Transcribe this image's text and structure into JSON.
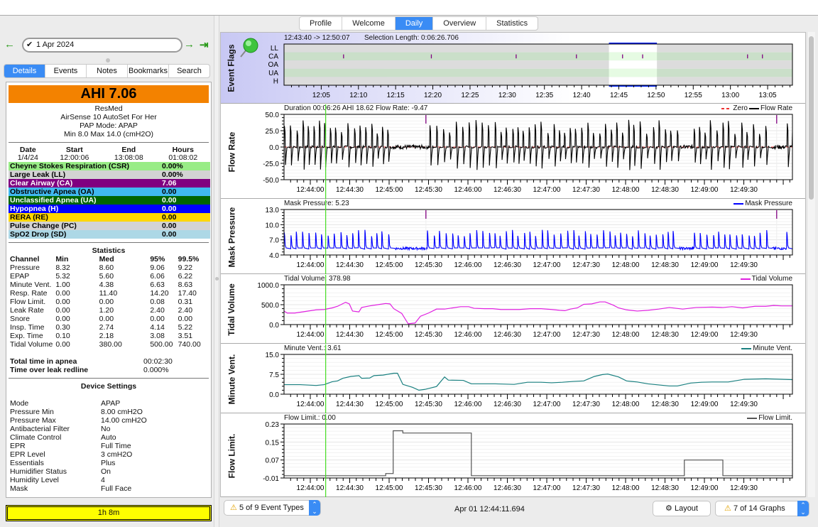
{
  "top_tabs": [
    {
      "label": "Profile",
      "active": false
    },
    {
      "label": "Welcome",
      "active": false
    },
    {
      "label": "Daily",
      "active": true
    },
    {
      "label": "Overview",
      "active": false
    },
    {
      "label": "Statistics",
      "active": false
    }
  ],
  "nav": {
    "prev_icon": "arrow-left-icon",
    "date": "1 Apr 2024",
    "next_icon": "arrow-right-icon",
    "last_icon": "arrow-to-end-icon"
  },
  "left_tabs": [
    {
      "label": "Details",
      "active": true
    },
    {
      "label": "Events",
      "active": false
    },
    {
      "label": "Notes",
      "active": false
    },
    {
      "label": "Bookmarks",
      "active": false
    },
    {
      "label": "Search",
      "active": false
    }
  ],
  "details": {
    "ahi": "AHI 7.06",
    "ahi_color": "#f38200",
    "brand": "ResMed",
    "model": "AirSense 10 AutoSet For Her",
    "mode": "PAP Mode: APAP",
    "pressure_range": "Min 8.0 Max 14.0 (cmH2O)",
    "session_headers": [
      "Date",
      "Start",
      "End",
      "Hours"
    ],
    "session_values": [
      "1/4/24",
      "12:00:06",
      "13:08:08",
      "01:08:02"
    ],
    "events": [
      {
        "label": "Cheyne Stokes Respiration (CSR)",
        "value": "0.00%",
        "bg": "#98ec86",
        "fg": "#000000"
      },
      {
        "label": "Large Leak (LL)",
        "value": "0.00%",
        "bg": "#d3d3d3",
        "fg": "#000000"
      },
      {
        "label": "Clear Airway (CA)",
        "value": "7.06",
        "bg": "#800080",
        "fg": "#ffffff"
      },
      {
        "label": "Obstructive Apnea (OA)",
        "value": "0.00",
        "bg": "#40b9f0",
        "fg": "#000000"
      },
      {
        "label": "Unclassified Apnea (UA)",
        "value": "0.00",
        "bg": "#006400",
        "fg": "#ffffff"
      },
      {
        "label": "Hypopnea (H)",
        "value": "0.00",
        "bg": "#0000ff",
        "fg": "#ffffff"
      },
      {
        "label": "RERA (RE)",
        "value": "0.00",
        "bg": "#ffd700",
        "fg": "#000000"
      },
      {
        "label": "Pulse Change (PC)",
        "value": "0.00",
        "bg": "#d3d3d3",
        "fg": "#000000"
      },
      {
        "label": "SpO2 Drop (SD)",
        "value": "0.00",
        "bg": "#add8e6",
        "fg": "#000000"
      }
    ],
    "statistics_title": "Statistics",
    "stats_headers": [
      "Channel",
      "Min",
      "Med",
      "95%",
      "99.5%"
    ],
    "stats": [
      [
        "Pressure",
        "8.32",
        "8.60",
        "9.06",
        "9.22"
      ],
      [
        "EPAP",
        "5.32",
        "5.60",
        "6.06",
        "6.22"
      ],
      [
        "Minute Vent.",
        "1.00",
        "4.38",
        "6.63",
        "8.63"
      ],
      [
        "Resp. Rate",
        "0.00",
        "11.40",
        "14.20",
        "17.40"
      ],
      [
        "Flow Limit.",
        "0.00",
        "0.00",
        "0.08",
        "0.31"
      ],
      [
        "Leak Rate",
        "0.00",
        "1.20",
        "2.40",
        "2.40"
      ],
      [
        "Snore",
        "0.00",
        "0.00",
        "0.00",
        "0.00"
      ],
      [
        "Insp. Time",
        "0.30",
        "2.74",
        "4.14",
        "5.22"
      ],
      [
        "Exp. Time",
        "0.10",
        "2.18",
        "3.08",
        "3.51"
      ],
      [
        "Tidal Volume",
        "0.00",
        "380.00",
        "500.00",
        "740.00"
      ]
    ],
    "apnea_time_label": "Total time in apnea",
    "apnea_time_value": "00:02:30",
    "leak_redline_label": "Time over leak redline",
    "leak_redline_value": "0.000%",
    "device_settings_title": "Device Settings",
    "device_settings": [
      [
        "Mode",
        "APAP"
      ],
      [
        "Pressure Min",
        "8.00 cmH2O"
      ],
      [
        "Pressure Max",
        "14.00 cmH2O"
      ],
      [
        "Antibacterial Filter",
        "No"
      ],
      [
        "Climate Control",
        "Auto"
      ],
      [
        "EPR",
        "Full Time"
      ],
      [
        "EPR Level",
        "3 cmH2O"
      ],
      [
        "Essentials",
        "Plus"
      ],
      [
        "Humidifier Status",
        "On"
      ],
      [
        "Humidity Level",
        "4"
      ],
      [
        "Mask",
        "Full Face"
      ]
    ],
    "usage": "1h 8m"
  },
  "event_flags": {
    "label": "Event Flags",
    "range": "12:43:40 -> 12:50:07",
    "selection": "Selection Length: 0:06:26.706",
    "rows": [
      "LL",
      "CA",
      "OA",
      "UA",
      "H"
    ],
    "x_ticks": [
      "12:05",
      "12:10",
      "12:15",
      "12:20",
      "12:25",
      "12:30",
      "12:35",
      "12:40",
      "12:45",
      "12:50",
      "12:55",
      "13:00",
      "13:05"
    ],
    "x_range_min": [
      12.0,
      13.1389
    ],
    "selection_min": [
      43.67,
      50.12
    ],
    "ca_events_min": [
      8.0,
      19.8,
      31.2,
      39.3,
      45.5,
      48.2,
      62.3,
      64.3
    ]
  },
  "charts": [
    {
      "id": "flow-rate",
      "ylabel": "Flow Rate",
      "title": "Duration 00:06:26 AHI 18.62 Flow Rate: -9.47",
      "legend": [
        {
          "name": "Zero",
          "color": "#e33333",
          "dash": true
        },
        {
          "name": "Flow Rate",
          "color": "#000000"
        }
      ],
      "yticks": [
        "50.0",
        "25.0",
        "0.0",
        "-25.0",
        "-50.0"
      ],
      "ylim": [
        -50,
        50
      ],
      "color": "#000000",
      "kind": "flow"
    },
    {
      "id": "mask-pressure",
      "ylabel": "Mask Pressure",
      "title": "Mask Pressure: 5.23",
      "legend": [
        {
          "name": "Mask Pressure",
          "color": "#0000ff"
        }
      ],
      "yticks": [
        "13.0",
        "10.0",
        "7.0",
        "4.0"
      ],
      "ylim": [
        4,
        13
      ],
      "color": "#0000ff",
      "kind": "pressure"
    },
    {
      "id": "tidal-volume",
      "ylabel": "Tidal Volume",
      "title": "Tidal Volume: 378.98",
      "legend": [
        {
          "name": "Tidal Volume",
          "color": "#e020e0"
        }
      ],
      "yticks": [
        "1000.0",
        "500.0",
        "0.0"
      ],
      "ylim": [
        0,
        1000
      ],
      "color": "#e020e0",
      "kind": "line",
      "points": [
        [
          0,
          340
        ],
        [
          6,
          290
        ],
        [
          20,
          290
        ],
        [
          40,
          330
        ],
        [
          60,
          370
        ],
        [
          75,
          380
        ],
        [
          90,
          420
        ],
        [
          100,
          460
        ],
        [
          115,
          560
        ],
        [
          122,
          520
        ],
        [
          128,
          340
        ],
        [
          140,
          320
        ],
        [
          145,
          430
        ],
        [
          160,
          470
        ],
        [
          175,
          500
        ],
        [
          190,
          530
        ],
        [
          198,
          520
        ],
        [
          205,
          400
        ],
        [
          220,
          280
        ],
        [
          232,
          20
        ],
        [
          245,
          40
        ],
        [
          255,
          210
        ],
        [
          270,
          290
        ],
        [
          285,
          390
        ],
        [
          300,
          390
        ],
        [
          315,
          420
        ],
        [
          330,
          450
        ],
        [
          345,
          450
        ],
        [
          355,
          410
        ],
        [
          375,
          400
        ],
        [
          390,
          400
        ],
        [
          405,
          380
        ],
        [
          420,
          380
        ],
        [
          440,
          380
        ],
        [
          460,
          400
        ],
        [
          480,
          400
        ],
        [
          500,
          380
        ],
        [
          515,
          360
        ],
        [
          525,
          350
        ],
        [
          535,
          390
        ],
        [
          548,
          420
        ],
        [
          560,
          510
        ],
        [
          575,
          520
        ],
        [
          590,
          570
        ],
        [
          600,
          570
        ],
        [
          615,
          490
        ],
        [
          625,
          420
        ],
        [
          640,
          370
        ],
        [
          660,
          340
        ],
        [
          680,
          360
        ],
        [
          700,
          390
        ],
        [
          720,
          430
        ],
        [
          745,
          390
        ],
        [
          770,
          430
        ],
        [
          800,
          440
        ],
        [
          820,
          430
        ],
        [
          837,
          450
        ],
        [
          857,
          420
        ],
        [
          880,
          460
        ],
        [
          900,
          460
        ],
        [
          915,
          480
        ],
        [
          930,
          470
        ],
        [
          950,
          470
        ]
      ]
    },
    {
      "id": "minute-vent",
      "ylabel": "Minute Vent.",
      "title": "Minute Vent.: 3.61",
      "legend": [
        {
          "name": "Minute Vent.",
          "color": "#1a8080"
        }
      ],
      "yticks": [
        "15.0",
        "7.5",
        "0.0"
      ],
      "ylim": [
        0,
        15
      ],
      "color": "#1a8080",
      "kind": "line",
      "points": [
        [
          0,
          3.6
        ],
        [
          30,
          3.6
        ],
        [
          60,
          3.3
        ],
        [
          75,
          3.6
        ],
        [
          90,
          4.7
        ],
        [
          100,
          5.0
        ],
        [
          110,
          6.0
        ],
        [
          125,
          6.7
        ],
        [
          140,
          7.0
        ],
        [
          145,
          6.0
        ],
        [
          160,
          6.1
        ],
        [
          168,
          7.0
        ],
        [
          185,
          7.2
        ],
        [
          205,
          7.9
        ],
        [
          212,
          7.9
        ],
        [
          222,
          3.7
        ],
        [
          240,
          2.6
        ],
        [
          252,
          1.5
        ],
        [
          263,
          1.8
        ],
        [
          285,
          2.9
        ],
        [
          300,
          6.5
        ],
        [
          307,
          5.3
        ],
        [
          335,
          5.2
        ],
        [
          350,
          3.9
        ],
        [
          395,
          3.9
        ],
        [
          430,
          3.7
        ],
        [
          455,
          4.5
        ],
        [
          480,
          4.5
        ],
        [
          500,
          4.3
        ],
        [
          520,
          4.5
        ],
        [
          540,
          4.8
        ],
        [
          560,
          5.0
        ],
        [
          580,
          6.7
        ],
        [
          595,
          7.4
        ],
        [
          605,
          7.6
        ],
        [
          625,
          6.5
        ],
        [
          640,
          5.0
        ],
        [
          660,
          4.6
        ],
        [
          680,
          3.9
        ],
        [
          700,
          3.5
        ],
        [
          720,
          3.1
        ],
        [
          735,
          3.1
        ],
        [
          760,
          4.2
        ],
        [
          780,
          4.5
        ],
        [
          800,
          4.6
        ],
        [
          830,
          4.6
        ],
        [
          860,
          5.6
        ],
        [
          900,
          5.8
        ],
        [
          950,
          5.5
        ]
      ]
    },
    {
      "id": "flow-limit",
      "ylabel": "Flow Limit.",
      "title": "Flow Limit.: 0.00",
      "legend": [
        {
          "name": "Flow Limit.",
          "color": "#555555"
        }
      ],
      "yticks": [
        "0.23",
        "0.15",
        "0.07",
        "-0.01"
      ],
      "ylim": [
        -0.01,
        0.23
      ],
      "color": "#555555",
      "kind": "step",
      "points": [
        [
          0,
          0.0
        ],
        [
          190,
          0.0
        ],
        [
          190,
          0.01
        ],
        [
          204,
          0.01
        ],
        [
          204,
          0.2
        ],
        [
          222,
          0.2
        ],
        [
          222,
          0.19
        ],
        [
          350,
          0.19
        ],
        [
          350,
          0.0
        ],
        [
          748,
          0.0
        ],
        [
          748,
          0.07
        ],
        [
          820,
          0.07
        ],
        [
          820,
          0.0
        ],
        [
          950,
          0.0
        ]
      ]
    }
  ],
  "x_axis": {
    "ticks": [
      "12:44:00",
      "12:44:30",
      "12:45:00",
      "12:45:30",
      "12:46:00",
      "12:46:30",
      "12:47:00",
      "12:47:30",
      "12:48:00",
      "12:48:30",
      "12:49:00",
      "12:49:30"
    ],
    "range_seconds": [
      0,
      387
    ],
    "first_tick_offset_s": 20,
    "cursor_s": 31.7,
    "ca_marker_s": [
      108,
      375
    ]
  },
  "bottom": {
    "event_types": "5 of 9 Event Types",
    "status": "Apr 01 12:44:11.694",
    "layout": "Layout",
    "graphs": "7 of 14 Graphs"
  }
}
